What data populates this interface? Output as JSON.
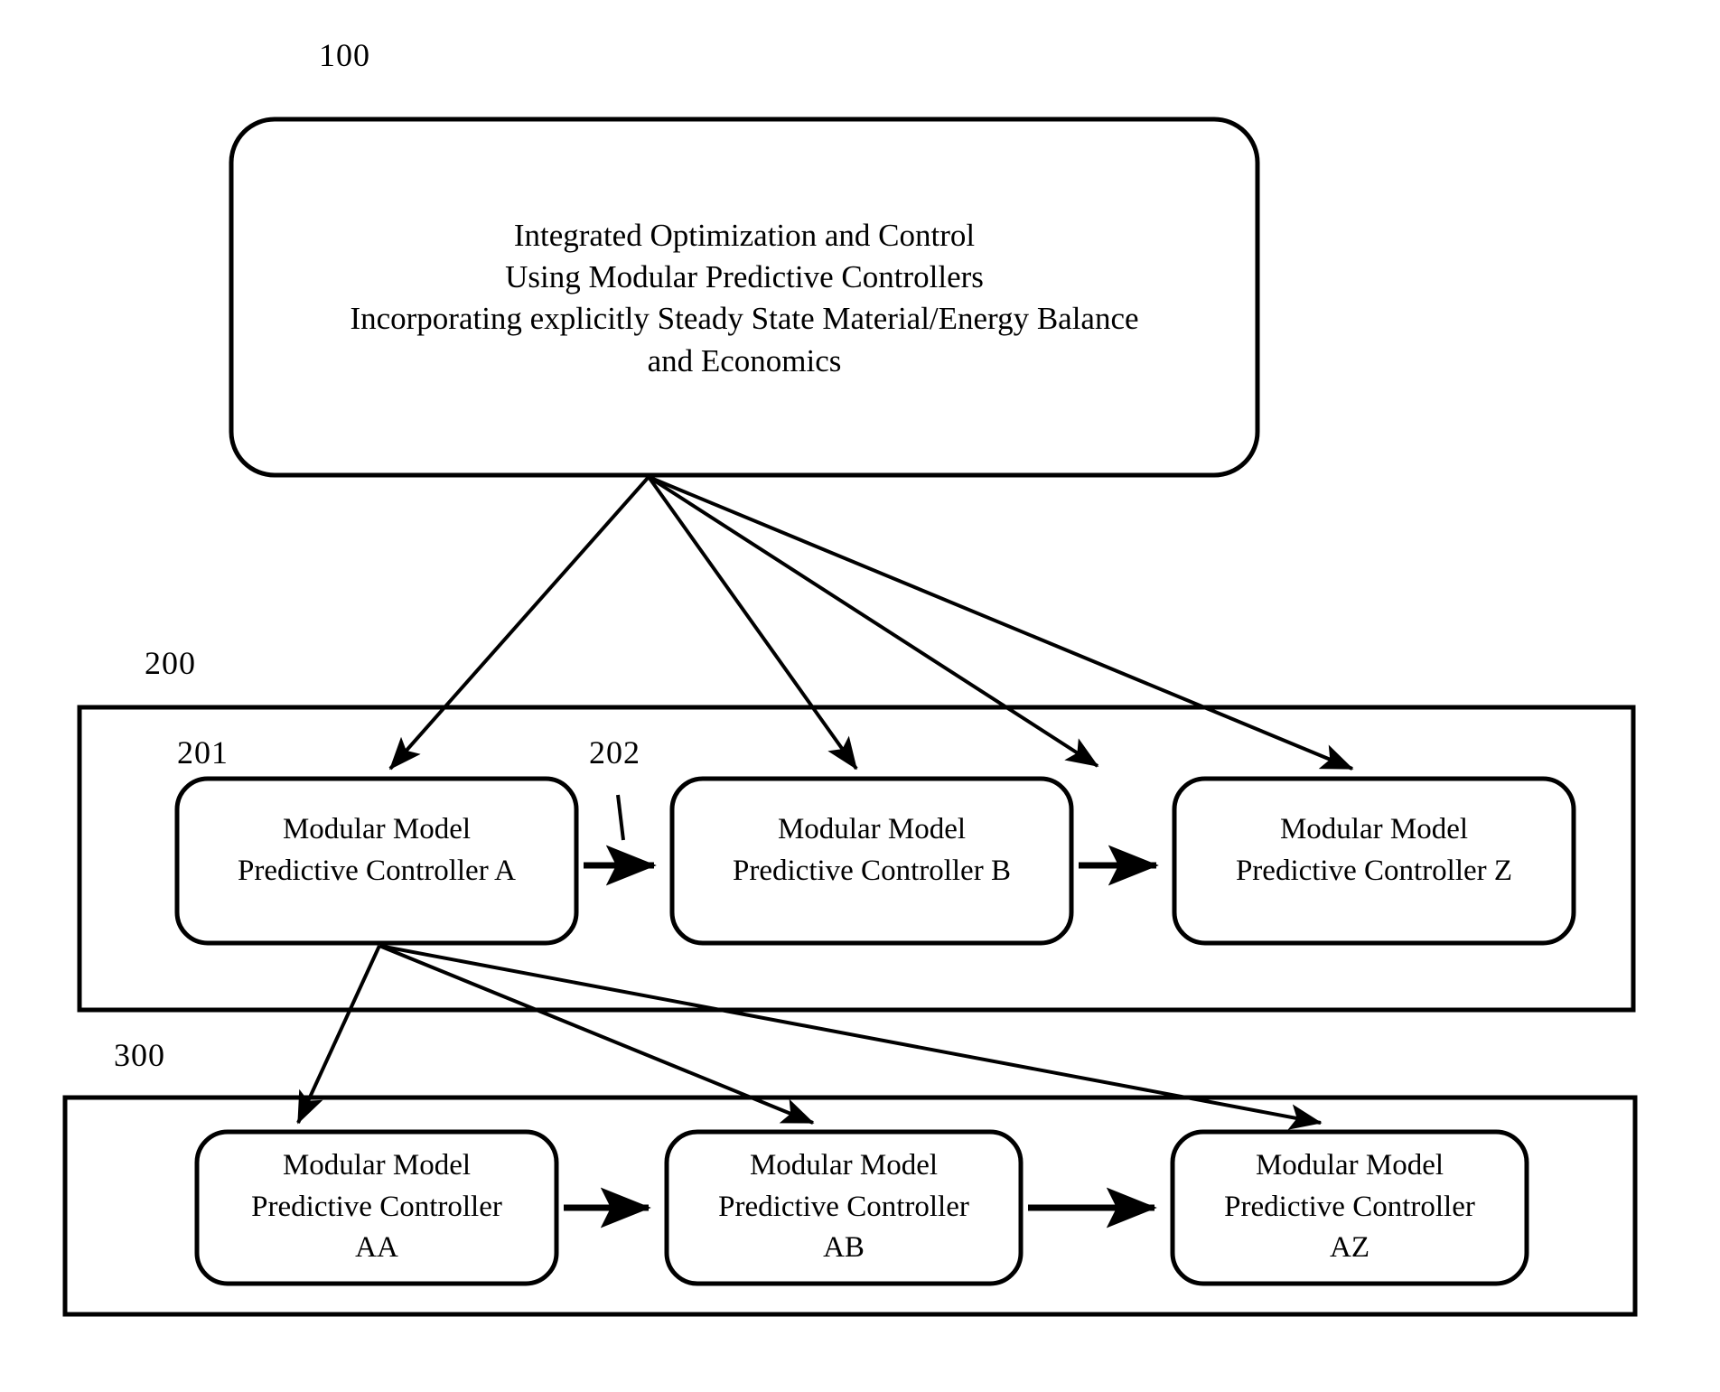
{
  "figure": {
    "kind": "patent-block-diagram",
    "background_color": "#ffffff",
    "stroke_color": "#000000"
  },
  "top_level": {
    "ref_number": "100",
    "title_lines": [
      "Integrated Optimization and Control",
      "Using Modular Predictive Controllers",
      "Incorporating explicitly Steady State Material/Energy Balance",
      "and Economics"
    ],
    "title_text": "Integrated Optimization and Control\nUsing Modular Predictive Controllers\nIncorporating explicitly Steady State Material/Energy Balance\nand Economics"
  },
  "middle_group": {
    "ref_number": "200",
    "controller_ref_number": "201",
    "connector_ref_number": "202",
    "controllers": [
      {
        "label": "Modular Model\nPredictive Controller A",
        "name": "controller-a"
      },
      {
        "label": "Modular Model\nPredictive Controller B",
        "name": "controller-b"
      },
      {
        "label": "Modular Model\nPredictive Controller Z",
        "name": "controller-z"
      }
    ]
  },
  "bottom_group": {
    "ref_number": "300",
    "controllers": [
      {
        "label": "Modular Model\nPredictive Controller\nAA",
        "name": "controller-aa"
      },
      {
        "label": "Modular Model\nPredictive Controller\nAB",
        "name": "controller-ab"
      },
      {
        "label": "Modular Model\nPredictive Controller\nAZ",
        "name": "controller-az"
      }
    ]
  }
}
